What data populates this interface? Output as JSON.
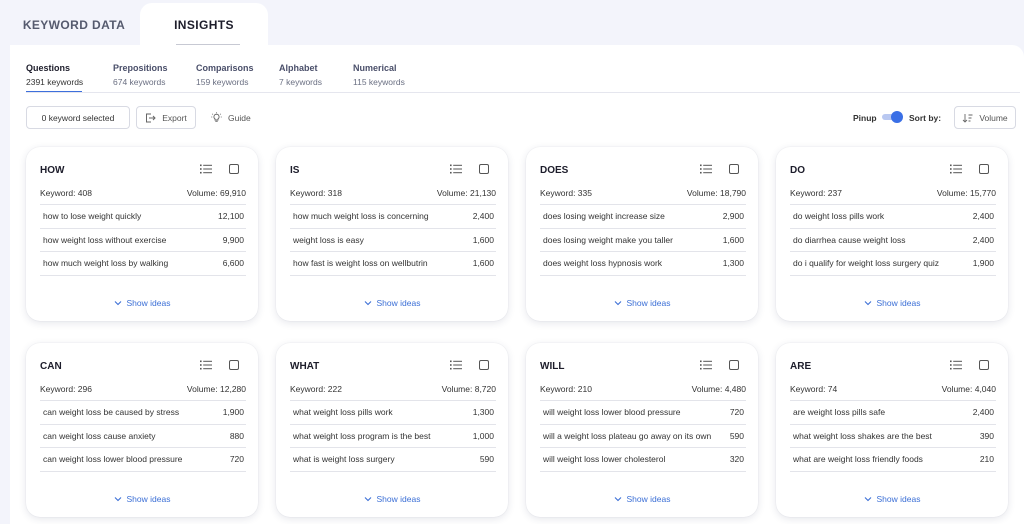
{
  "top_tabs": [
    {
      "label": "KEYWORD DATA"
    },
    {
      "label": "INSIGHTS"
    }
  ],
  "subtabs": [
    {
      "title": "Questions",
      "count": "2391 keywords"
    },
    {
      "title": "Prepositions",
      "count": "674 keywords"
    },
    {
      "title": "Comparisons",
      "count": "159 keywords"
    },
    {
      "title": "Alphabet",
      "count": "7 keywords"
    },
    {
      "title": "Numerical",
      "count": "115 keywords"
    }
  ],
  "toolbar": {
    "selected": "0 keyword selected",
    "export": "Export",
    "guide": "Guide",
    "pinup": "Pinup",
    "sort_by": "Sort by:",
    "sort_value": "Volume"
  },
  "show_ideas": "Show ideas",
  "cards": [
    {
      "title": "HOW",
      "keyword": "Keyword: 408",
      "volume": "Volume: 69,910",
      "rows": [
        {
          "text": "how to lose weight quickly",
          "vol": "12,100"
        },
        {
          "text": "how weight loss without exercise",
          "vol": "9,900"
        },
        {
          "text": "how much weight loss by walking",
          "vol": "6,600"
        }
      ]
    },
    {
      "title": "IS",
      "keyword": "Keyword: 318",
      "volume": "Volume: 21,130",
      "rows": [
        {
          "text": "how much weight loss is concerning",
          "vol": "2,400"
        },
        {
          "text": "weight loss is easy",
          "vol": "1,600"
        },
        {
          "text": "how fast is weight loss on wellbutrin",
          "vol": "1,600"
        }
      ]
    },
    {
      "title": "DOES",
      "keyword": "Keyword: 335",
      "volume": "Volume: 18,790",
      "rows": [
        {
          "text": "does losing weight increase size",
          "vol": "2,900"
        },
        {
          "text": "does losing weight make you taller",
          "vol": "1,600"
        },
        {
          "text": "does weight loss hypnosis work",
          "vol": "1,300"
        }
      ]
    },
    {
      "title": "DO",
      "keyword": "Keyword: 237",
      "volume": "Volume: 15,770",
      "rows": [
        {
          "text": "do weight loss pills work",
          "vol": "2,400"
        },
        {
          "text": "do diarrhea cause weight loss",
          "vol": "2,400"
        },
        {
          "text": "do i qualify for weight loss surgery quiz",
          "vol": "1,900"
        }
      ]
    },
    {
      "title": "CAN",
      "keyword": "Keyword: 296",
      "volume": "Volume: 12,280",
      "rows": [
        {
          "text": "can weight loss be caused by stress",
          "vol": "1,900"
        },
        {
          "text": "can weight loss cause anxiety",
          "vol": "880"
        },
        {
          "text": "can weight loss lower blood pressure",
          "vol": "720"
        }
      ]
    },
    {
      "title": "WHAT",
      "keyword": "Keyword: 222",
      "volume": "Volume: 8,720",
      "rows": [
        {
          "text": "what weight loss pills work",
          "vol": "1,300"
        },
        {
          "text": "what weight loss program is the best",
          "vol": "1,000"
        },
        {
          "text": "what is weight loss surgery",
          "vol": "590"
        }
      ]
    },
    {
      "title": "WILL",
      "keyword": "Keyword: 210",
      "volume": "Volume: 4,480",
      "rows": [
        {
          "text": "will weight loss lower blood pressure",
          "vol": "720"
        },
        {
          "text": "will a weight loss plateau go away on its own",
          "vol": "590"
        },
        {
          "text": "will weight loss lower cholesterol",
          "vol": "320"
        }
      ]
    },
    {
      "title": "ARE",
      "keyword": "Keyword: 74",
      "volume": "Volume: 4,040",
      "rows": [
        {
          "text": "are weight loss pills safe",
          "vol": "2,400"
        },
        {
          "text": "what weight loss shakes are the best",
          "vol": "390"
        },
        {
          "text": "what are weight loss friendly foods",
          "vol": "210"
        }
      ]
    }
  ]
}
